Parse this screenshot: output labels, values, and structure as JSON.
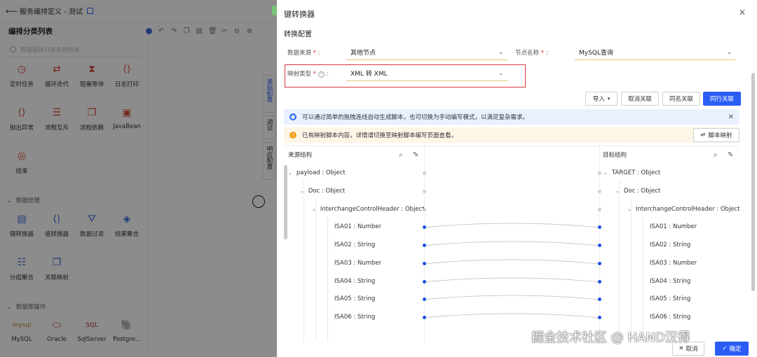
{
  "window": {
    "title": "服务编排定义 - 测试"
  },
  "left_panel": {
    "title": "编排分类列表",
    "search_placeholder": "根据编排分类名称检索",
    "row1": [
      "定时任务",
      "循环迭代",
      "阻塞等待",
      "日志打印"
    ],
    "row2": [
      "抛出异常",
      "流程互斥",
      "流程依赖",
      "JavaBean"
    ],
    "row3": [
      "结束"
    ],
    "section_data": "数据处理",
    "row4": [
      "键转换器",
      "值转换器",
      "数据过滤",
      "结果聚合"
    ],
    "row5": [
      "分组聚合",
      "关联映射"
    ],
    "section_db": "数据库操作",
    "row6": [
      "MySQL",
      "Oracle",
      "SqlServer",
      "Postgre..."
    ]
  },
  "side_tabs": {
    "basic": "基础配置",
    "debug": "调试",
    "response": "响应配置"
  },
  "modal": {
    "title": "键转换器",
    "section": "转换配置",
    "source_label": "数据来源",
    "source_value": "其他节点",
    "node_label": "节点名称",
    "node_value": "MySQL查询",
    "mapping_label": "映射类型",
    "mapping_value": "XML 转 XML",
    "buttons": {
      "import": "导入",
      "cancel_link": "取消关联",
      "same_name": "同名关联",
      "same_row": "同行关联"
    },
    "info_blue": "可以通过简单的拖拽连线自动生成脚本，也可切换为手动编写模式，以满足复杂需求。",
    "info_yellow": "已有映射脚本内容，详情请切换至映射脚本编写页面查看。",
    "script_map": "脚本映射",
    "source_structure": "来源结构",
    "target_structure": "目标结构",
    "source_tree": [
      "payload : Object",
      "Doc : Object",
      "InterchangeControlHeader : Object",
      "ISA01 : Number",
      "ISA02 : String",
      "ISA03 : Number",
      "ISA04 : String",
      "ISA05 : String",
      "ISA06 : String"
    ],
    "target_tree": [
      "TARGET : Object",
      "Doc : Object",
      "InterchangeControlHeader : Object",
      "ISA01 : Number",
      "ISA02 : String",
      "ISA03 : Number",
      "ISA04 : String",
      "ISA05 : String",
      "ISA06 : String"
    ],
    "footer": {
      "cancel": "取消",
      "confirm": "确定"
    }
  },
  "watermark": "掘金技术社区 @ HAND汉得",
  "colors": {
    "primary": "#2b5df5",
    "highlight": "#d9363e",
    "link": "#1e50e6"
  }
}
